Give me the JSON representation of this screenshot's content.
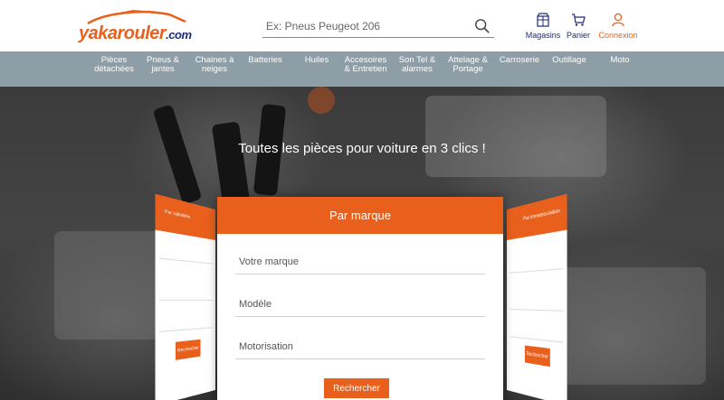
{
  "header": {
    "logo_text": "yakarouler",
    "logo_domain": ".com",
    "search": {
      "placeholder": "Ex: Pneus Peugeot 206",
      "value": ""
    },
    "icons": {
      "magasins_label": "Magasins",
      "panier_label": "Panier",
      "connexion_label": "Connexion"
    }
  },
  "nav": {
    "items": [
      {
        "label": "Pièces détachées"
      },
      {
        "label": "Pneus & jantes"
      },
      {
        "label": "Chaines à neiges"
      },
      {
        "label": "Batteries"
      },
      {
        "label": "Huiles"
      },
      {
        "label": "Accesoires & Entretien"
      },
      {
        "label": "Son Tel & alarmes"
      },
      {
        "label": "Attelage & Portage"
      },
      {
        "label": "Carroserie"
      },
      {
        "label": "Outillage"
      },
      {
        "label": "Moto"
      }
    ]
  },
  "hero": {
    "title": "Toutes les pièces pour voiture en 3 clics !"
  },
  "card_left": {
    "title": "Par cylindrée",
    "button": "Rechercher"
  },
  "card_right": {
    "title": "Par immatriculation",
    "button": "Rechercher"
  },
  "main_card": {
    "title": "Par marque",
    "fields": [
      {
        "placeholder": "Votre marque"
      },
      {
        "placeholder": "Modèle"
      },
      {
        "placeholder": "Motorisation"
      }
    ],
    "submit_label": "Rechercher"
  },
  "colors": {
    "accent": "#e8601c",
    "nav_bg": "#8d9ea6",
    "brand_blue": "#1e2a78"
  }
}
